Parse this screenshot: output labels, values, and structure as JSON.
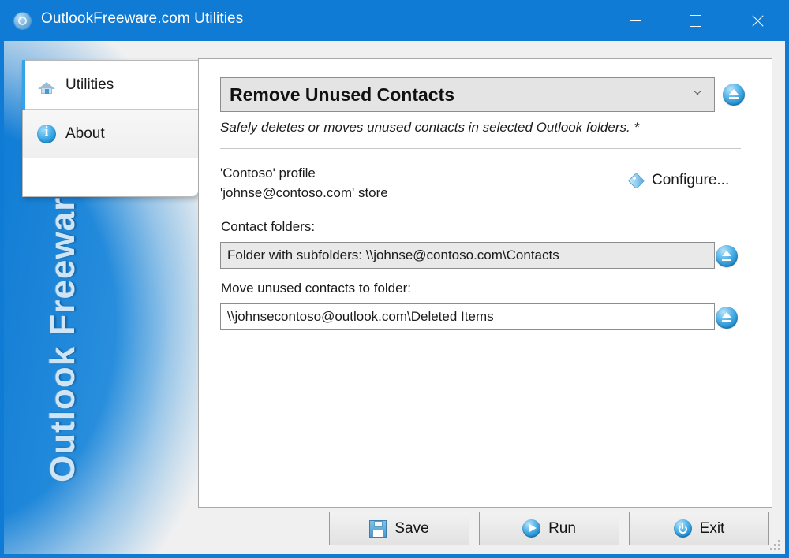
{
  "window": {
    "title": "OutlookFreeware.com Utilities",
    "icon": "app-logo-icon",
    "controls": {
      "minimize": "minimize-icon",
      "maximize": "maximize-icon",
      "close": "close-icon"
    },
    "watermark": "Outlook Freeware .com",
    "accent_color": "#0f7bd4"
  },
  "sidebar": {
    "tabs": [
      {
        "label": "Utilities",
        "icon": "home-icon",
        "active": true
      },
      {
        "label": "About",
        "icon": "info-icon",
        "active": false
      }
    ]
  },
  "main": {
    "utility_select": {
      "value": "Remove Unused Contacts",
      "chevron": "chevron-down-icon",
      "browse": "eject-icon"
    },
    "description": "Safely deletes or moves unused contacts in selected Outlook folders. *",
    "profile_line_1": "'Contoso' profile",
    "profile_line_2": "'johnse@contoso.com' store",
    "configure": {
      "label": "Configure...",
      "icon": "tag-icon"
    },
    "fields": [
      {
        "label": "Contact folders:",
        "value": "Folder with subfolders: \\\\johnse@contoso.com\\Contacts",
        "browse": "eject-icon"
      },
      {
        "label": "Move unused contacts to folder:",
        "value": "\\\\johnsecontoso@outlook.com\\Deleted Items",
        "browse": "eject-icon"
      }
    ]
  },
  "footer": {
    "buttons": [
      {
        "label": "Save",
        "icon": "floppy-disk-icon"
      },
      {
        "label": "Run",
        "icon": "play-icon"
      },
      {
        "label": "Exit",
        "icon": "power-icon"
      }
    ]
  }
}
